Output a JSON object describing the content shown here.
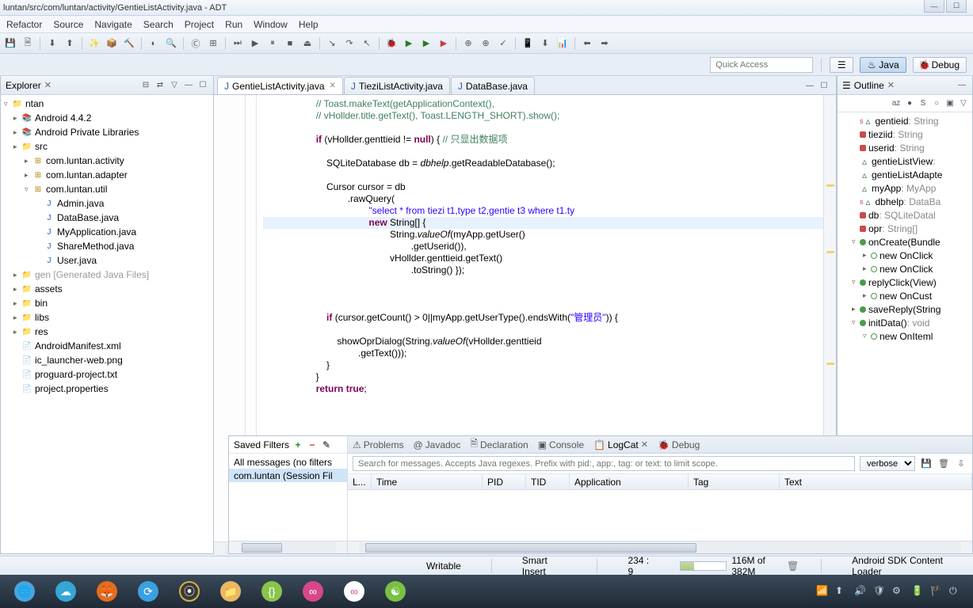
{
  "window": {
    "title": "luntan/src/com/luntan/activity/GentieListActivity.java - ADT"
  },
  "menu": [
    "Refactor",
    "Source",
    "Navigate",
    "Search",
    "Project",
    "Run",
    "Window",
    "Help"
  ],
  "quick_access": {
    "placeholder": "Quick Access"
  },
  "perspectives": {
    "java": "Java",
    "debug": "Debug"
  },
  "explorer": {
    "title": "Explorer",
    "root": "ntan",
    "nodes": [
      {
        "t": "lib",
        "l": "Android 4.4.2",
        "d": 1
      },
      {
        "t": "lib",
        "l": "Android Private Libraries",
        "d": 1
      },
      {
        "t": "srcfolder",
        "l": "src",
        "d": 1
      },
      {
        "t": "pkg",
        "l": "com.luntan.activity",
        "d": 2
      },
      {
        "t": "pkg",
        "l": "com.luntan.adapter",
        "d": 2
      },
      {
        "t": "pkg",
        "l": "com.luntan.util",
        "d": 2,
        "open": true
      },
      {
        "t": "java",
        "l": "Admin.java",
        "d": 3
      },
      {
        "t": "java",
        "l": "DataBase.java",
        "d": 3
      },
      {
        "t": "java",
        "l": "MyApplication.java",
        "d": 3
      },
      {
        "t": "java",
        "l": "ShareMethod.java",
        "d": 3
      },
      {
        "t": "java",
        "l": "User.java",
        "d": 3
      },
      {
        "t": "srcfolder",
        "l": "gen [Generated Java Files]",
        "d": 1,
        "gray": true
      },
      {
        "t": "folder",
        "l": "assets",
        "d": 1
      },
      {
        "t": "folder",
        "l": "bin",
        "d": 1
      },
      {
        "t": "folder",
        "l": "libs",
        "d": 1
      },
      {
        "t": "folder",
        "l": "res",
        "d": 1
      },
      {
        "t": "file",
        "l": "AndroidManifest.xml",
        "d": 1
      },
      {
        "t": "file",
        "l": "ic_launcher-web.png",
        "d": 1
      },
      {
        "t": "file",
        "l": "proguard-project.txt",
        "d": 1
      },
      {
        "t": "file",
        "l": "project.properties",
        "d": 1
      }
    ]
  },
  "editor": {
    "tabs": [
      {
        "l": "GentieListActivity.java",
        "active": true,
        "close": true
      },
      {
        "l": "TieziListActivity.java",
        "active": false,
        "close": false
      },
      {
        "l": "DataBase.java",
        "active": false,
        "close": false
      }
    ],
    "code_lines": [
      [
        "                    ",
        "c",
        "// Toast.makeText(getApplicationContext(),"
      ],
      [
        "                    ",
        "c",
        "// vHollder.title.getText(), Toast.LENGTH_SHORT).show();"
      ],
      [
        ""
      ],
      [
        "                    ",
        "k",
        "if",
        " (vHollder.genttieid != ",
        "k",
        "null",
        ") { ",
        "ch",
        "// 只显出数据项"
      ],
      [
        ""
      ],
      [
        "                        SQLiteDatabase db = ",
        "m",
        "dbhelp",
        ".getReadableDatabase();"
      ],
      [
        ""
      ],
      [
        "                        Cursor cursor = db"
      ],
      [
        "                                .rawQuery("
      ],
      [
        "                                        ",
        "s",
        "\"select * from tiezi t1,type t2,gentie t3 where t1.ty"
      ],
      [
        "CARET",
        "                                        ",
        "k",
        "new",
        " String[] {"
      ],
      [
        "                                                String.",
        "m",
        "valueOf",
        "(myApp.getUser()"
      ],
      [
        "                                                        .getUserid()),"
      ],
      [
        "                                                vHollder.genttieid.getText()"
      ],
      [
        "                                                        .toString() });"
      ],
      [
        ""
      ],
      [
        ""
      ],
      [
        ""
      ],
      [
        "                        ",
        "k",
        "if",
        " (cursor.getCount() > 0||myApp.getUserType().endsWith(",
        "s",
        "\"管理员\"",
        ")) {"
      ],
      [
        ""
      ],
      [
        "                            showOprDialog(String.",
        "m",
        "valueOf",
        "(vHollder.genttieid"
      ],
      [
        "                                    .getText()));"
      ],
      [
        "                        }"
      ],
      [
        "                    }"
      ],
      [
        "                    ",
        "k",
        "return true",
        ";"
      ]
    ]
  },
  "outline": {
    "title": "Outline",
    "nodes": [
      {
        "i": "field-def",
        "l": "gentieid",
        "t": " : String",
        "d": 1,
        "s": true
      },
      {
        "i": "field-priv",
        "l": "tieziid",
        "t": " : String",
        "d": 1
      },
      {
        "i": "field-priv",
        "l": "userid",
        "t": " : String",
        "d": 1
      },
      {
        "i": "tri",
        "l": "gentieListView",
        "t": " : ",
        "d": 1
      },
      {
        "i": "tri",
        "l": "gentieListAdapte",
        "t": "",
        "d": 1
      },
      {
        "i": "tri",
        "l": "myApp",
        "t": " : MyApp",
        "d": 1
      },
      {
        "i": "field-def",
        "l": "dbhelp",
        "t": " : DataBa",
        "d": 1,
        "s": true
      },
      {
        "i": "field-priv",
        "l": "db",
        "t": " : SQLiteDatal",
        "d": 1
      },
      {
        "i": "field-priv",
        "l": "opr",
        "t": " : String[]",
        "d": 1
      },
      {
        "i": "method",
        "l": "onCreate(Bundle",
        "t": "",
        "d": 1,
        "open": true
      },
      {
        "i": "cls",
        "l": "new OnClick",
        "t": "",
        "d": 2
      },
      {
        "i": "cls",
        "l": "new OnClick",
        "t": "",
        "d": 2
      },
      {
        "i": "method",
        "l": "replyClick(View)",
        "t": "",
        "d": 1,
        "open": true
      },
      {
        "i": "cls",
        "l": "new OnCust",
        "t": "",
        "d": 2
      },
      {
        "i": "method",
        "l": "saveReply(String",
        "t": "",
        "d": 1
      },
      {
        "i": "method",
        "l": "initData()",
        "t": " : void",
        "d": 1,
        "open": true
      },
      {
        "i": "cls",
        "l": "new OnIteml",
        "t": "",
        "d": 2,
        "open": true
      }
    ]
  },
  "bottom": {
    "tabs": [
      "Problems",
      "Javadoc",
      "Declaration",
      "Console",
      "LogCat",
      "Debug"
    ],
    "active_tab": 4,
    "saved_filters": {
      "title": "Saved Filters",
      "items": [
        "All messages (no filters",
        "com.luntan (Session Fil"
      ]
    },
    "search_placeholder": "Search for messages. Accepts Java regexes. Prefix with pid:, app:, tag: or text: to limit scope.",
    "level": "verbose",
    "columns": [
      "L...",
      "Time",
      "PID",
      "TID",
      "Application",
      "Tag",
      "Text"
    ]
  },
  "status": {
    "writable": "Writable",
    "insert": "Smart Insert",
    "pos": "234 : 9",
    "heap": "116M of 382M",
    "job": "Android SDK Content Loader"
  }
}
